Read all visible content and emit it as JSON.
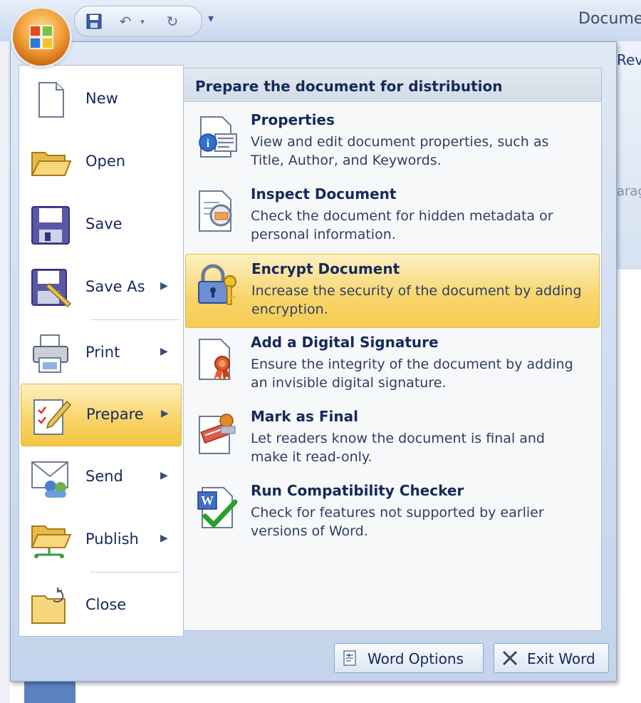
{
  "window": {
    "title": "Docume",
    "qat": {
      "save_icon": "save-icon",
      "undo_icon": "undo-icon",
      "undo_dropdown_icon": "chevron-down-icon",
      "redo_icon": "redo-icon",
      "customize_icon": "chevron-down-icon"
    },
    "ribbon": {
      "tab_fragment": "Rev",
      "group_fragment": "arag"
    }
  },
  "office_menu": {
    "left_items": [
      {
        "label": "New",
        "icon": "new-document-icon",
        "submenu": false
      },
      {
        "label": "Open",
        "icon": "open-folder-icon",
        "submenu": false
      },
      {
        "label": "Save",
        "icon": "save-icon",
        "submenu": false
      },
      {
        "label": "Save As",
        "icon": "save-as-icon",
        "submenu": true
      },
      {
        "label": "Print",
        "icon": "printer-icon",
        "submenu": true
      },
      {
        "label": "Prepare",
        "icon": "prepare-icon",
        "submenu": true,
        "active": true
      },
      {
        "label": "Send",
        "icon": "send-icon",
        "submenu": true
      },
      {
        "label": "Publish",
        "icon": "publish-icon",
        "submenu": true
      },
      {
        "label": "Close",
        "icon": "close-folder-icon",
        "submenu": false
      }
    ],
    "submenu_arrow": "▶",
    "prepare_panel": {
      "header": "Prepare the document for distribution",
      "items": [
        {
          "title": "Properties",
          "description": "View and edit document properties, such as Title, Author, and Keywords.",
          "icon": "properties-icon"
        },
        {
          "title": "Inspect Document",
          "description": "Check the document for hidden metadata or personal information.",
          "icon": "inspect-document-icon"
        },
        {
          "title": "Encrypt Document",
          "description": "Increase the security of the document by adding encryption.",
          "icon": "lock-key-icon",
          "highlighted": true
        },
        {
          "title": "Add a Digital Signature",
          "description": "Ensure the integrity of the document by adding an invisible digital signature.",
          "icon": "signature-ribbon-icon"
        },
        {
          "title": "Mark as Final",
          "description": "Let readers know the document is final and make it read-only.",
          "icon": "mark-final-icon"
        },
        {
          "title": "Run Compatibility Checker",
          "description": "Check for features not supported by earlier versions of Word.",
          "icon": "compatibility-check-icon"
        }
      ]
    },
    "footer": {
      "word_options": "Word Options",
      "exit_word": "Exit Word"
    }
  },
  "colors": {
    "highlight": "#f8d46a",
    "text": "#15295a",
    "office_button": "#f3a23a"
  }
}
